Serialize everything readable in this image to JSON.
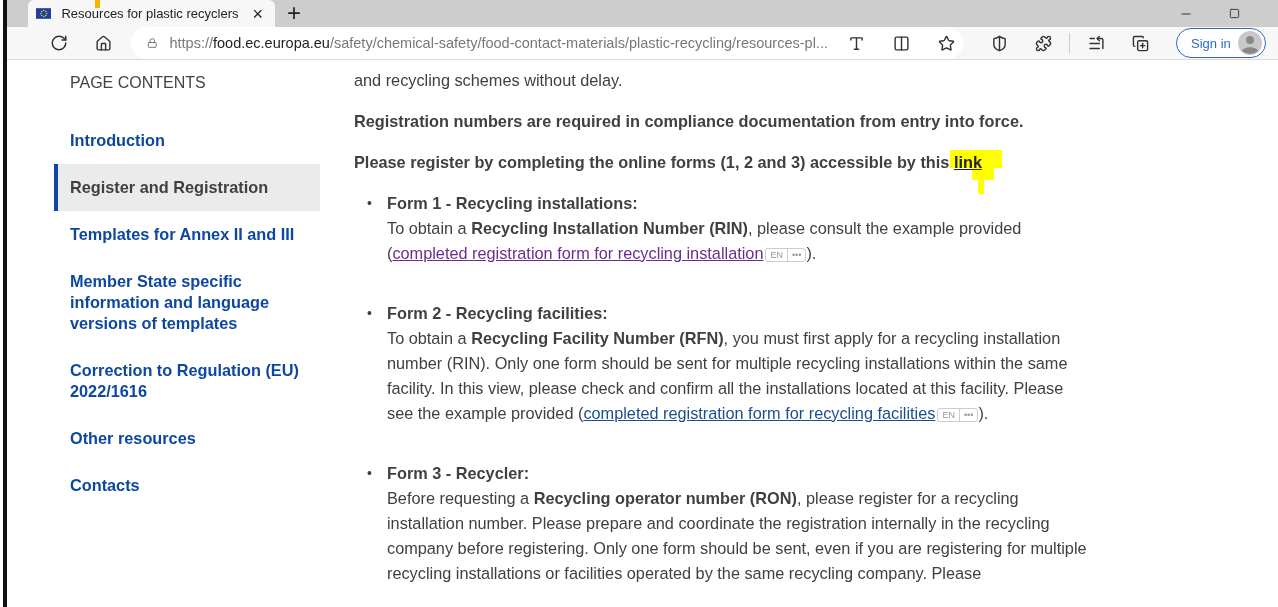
{
  "browser": {
    "tab": {
      "title": "Resources for plastic recyclers",
      "close": "×",
      "selected": true
    },
    "new_tab": "+",
    "address": {
      "scheme": "https://",
      "domain": "food.ec.europa.eu",
      "path": "/safety/chemical-safety/food-contact-materials/plastic-recycling/resources-pl..."
    },
    "sign_in": "Sign in"
  },
  "sidebar": {
    "heading": "PAGE CONTENTS",
    "items": [
      {
        "label": "Introduction",
        "selected": false
      },
      {
        "label": "Register and Registration",
        "selected": true
      },
      {
        "label": "Templates for Annex II and III",
        "selected": false
      },
      {
        "label": "Member State specific information and language versions of templates",
        "selected": false
      },
      {
        "label": "Correction to Regulation (EU) 2022/1616",
        "selected": false
      },
      {
        "label": "Other resources",
        "selected": false
      },
      {
        "label": "Contacts",
        "selected": false
      }
    ]
  },
  "content": {
    "intro": "and recycling schemes without delay.",
    "notice": "Registration numbers are required in compliance documentation from entry into force.",
    "register": {
      "text": "Please register by completing the online forms (1, 2 and 3) accessible by this",
      "link": "link",
      "highlighted": true
    },
    "forms": [
      {
        "bullet": "•",
        "title": "Form 1 - Recycling installations:",
        "text": "To obtain a **Recycling Installation Number (RIN)**, please consult the example provided",
        "link_open": "(",
        "link": "completed registration form for recycling installation",
        "visited": true,
        "badge": "EN",
        "badge_more": "•••",
        "link_close": ")."
      },
      {
        "bullet": "•",
        "title": "Form 2 - Recycling facilities:",
        "text": "To obtain a **Recycling Facility Number (RFN)**, you must first apply for a recycling installation number (RIN). Only one form should be sent for multiple recycling installations within the same facility. In this view, please check and confirm all the installations located at this facility. Please see the example provided",
        "link_open": "(",
        "link": "completed registration form for recycling facilities",
        "visited": false,
        "badge": "EN",
        "badge_more": "•••",
        "link_close": ")."
      },
      {
        "bullet": "•",
        "title": "Form 3 - Recycler:",
        "text": "Before requesting a **Recycling operator number (RON)**, please register for a recycling installation number. Please prepare and coordinate the registration internally in the recycling company before registering. Only one form should be sent, even if you are registering for multiple recycling installations or facilities operated by the same recycling company. Please"
      }
    ]
  }
}
